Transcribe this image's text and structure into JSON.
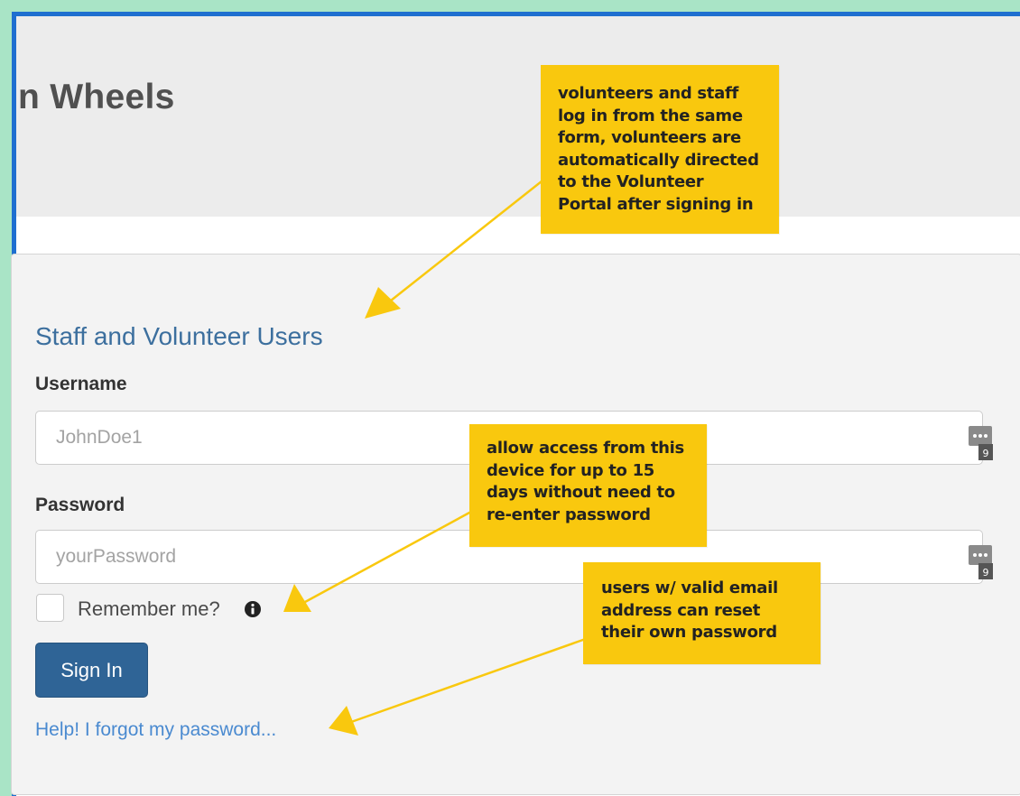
{
  "header": {
    "app_title": "n Wheels"
  },
  "login": {
    "title": "Staff and Volunteer Users",
    "username_label": "Username",
    "username_placeholder": "JohnDoe1",
    "password_label": "Password",
    "password_placeholder": "yourPassword",
    "remember_label": "Remember me?",
    "sign_in_label": "Sign In",
    "forgot_link": "Help! I forgot my password..."
  },
  "annotations": {
    "note1": [
      "volunteers and staff",
      "log in from the same",
      "form, volunteers are",
      "automatically directed",
      "to the Volunteer",
      "Portal after signing in"
    ],
    "note2": [
      "allow access from this",
      "device for up to 15",
      "days without need to",
      "re-enter password"
    ],
    "note3": [
      "users w/ valid email",
      "address can reset",
      "their own password"
    ]
  },
  "colors": {
    "frame_border": "#1e6fd0",
    "note_background": "#f9c80e",
    "button_primary": "#2f6496",
    "link": "#4a8ad0",
    "title_blue": "#3c6f9e"
  },
  "icons": {
    "password_manager": "password-manager-icon",
    "info": "info-circle-icon",
    "arrow": "arrow-pointer-icon"
  }
}
